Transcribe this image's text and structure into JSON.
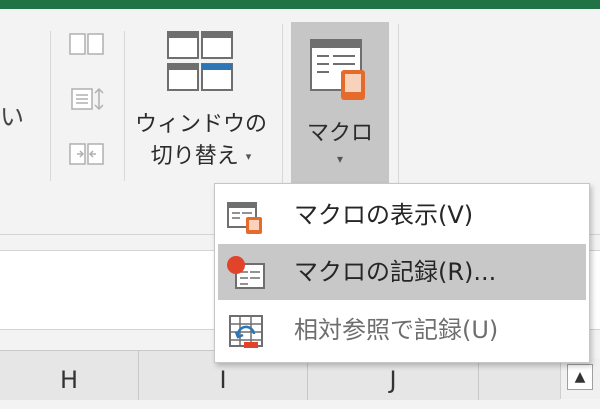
{
  "ribbon": {
    "cut_text": "い",
    "window_switch": {
      "line1": "ウィンドウの",
      "line2": "切り替え"
    },
    "macro": {
      "label": "マクロ"
    }
  },
  "macro_menu": {
    "items": [
      {
        "label": "マクロの表示(V)",
        "icon": "macro-view-icon"
      },
      {
        "label": "マクロの記録(R)...",
        "icon": "macro-record-icon",
        "highlighted": true
      },
      {
        "label": "相対参照で記録(U)",
        "icon": "relative-reference-icon"
      }
    ]
  },
  "sheet": {
    "columns": [
      "H",
      "I",
      "J"
    ]
  },
  "colors": {
    "title_bar": "#217346",
    "accent_orange": "#e46b2b",
    "record_dot": "#e2432b",
    "highlight": "#c8c8c8"
  }
}
